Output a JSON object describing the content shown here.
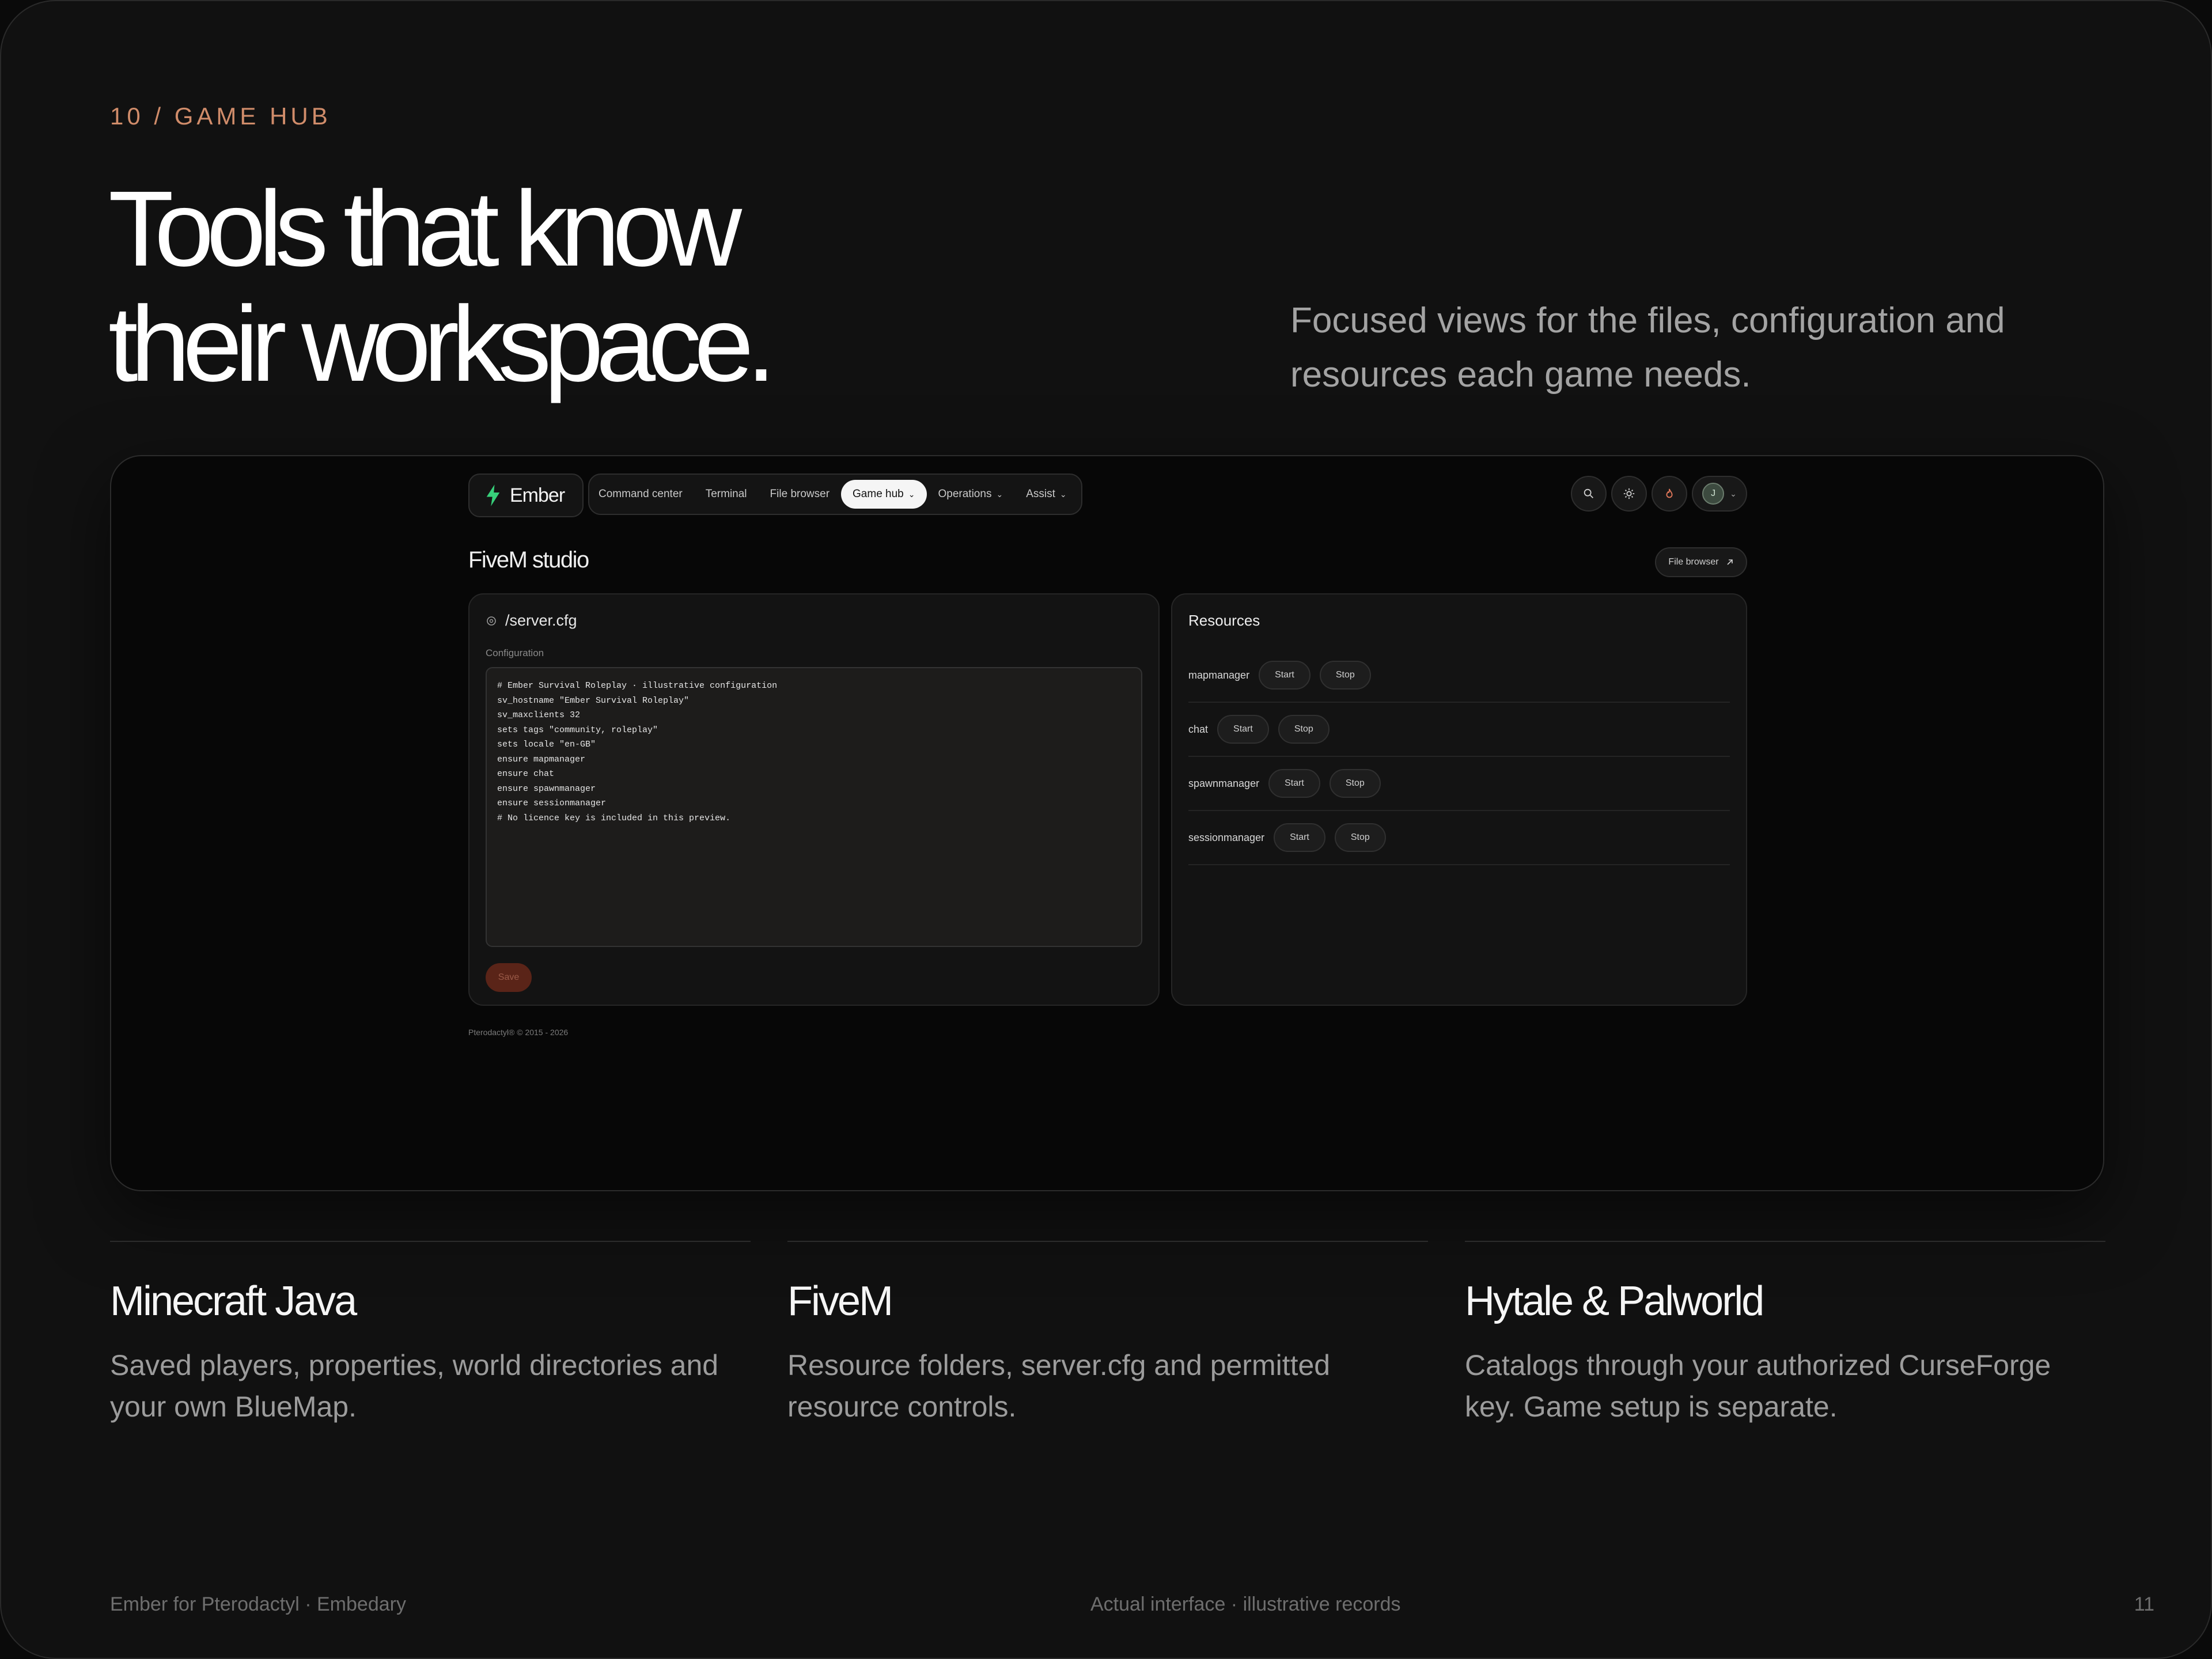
{
  "eyebrow": "10 / GAME HUB",
  "headline": {
    "line1": "Tools that know",
    "line2": "their workspace."
  },
  "lede": "Focused views for the files, configuration and resources each game needs.",
  "app": {
    "brand": "Ember",
    "nav": [
      {
        "label": "Command center"
      },
      {
        "label": "Terminal"
      },
      {
        "label": "File browser"
      },
      {
        "label": "Game hub",
        "active": true,
        "dropdown": true
      },
      {
        "label": "Operations",
        "dropdown": true
      },
      {
        "label": "Assist",
        "dropdown": true
      }
    ],
    "toolbar_icons": [
      "search-icon",
      "sun-icon",
      "flame-icon"
    ],
    "avatar_initial": "J",
    "studio_title": "FiveM studio",
    "file_browser_button": "File browser",
    "config": {
      "filename": "/server.cfg",
      "label": "Configuration",
      "content": "# Ember Survival Roleplay · illustrative configuration\nsv_hostname \"Ember Survival Roleplay\"\nsv_maxclients 32\nsets tags \"community, roleplay\"\nsets locale \"en-GB\"\nensure mapmanager\nensure chat\nensure spawnmanager\nensure sessionmanager\n# No licence key is included in this preview.",
      "save_label": "Save"
    },
    "resources": {
      "title": "Resources",
      "start_label": "Start",
      "stop_label": "Stop",
      "items": [
        {
          "name": "mapmanager"
        },
        {
          "name": "chat"
        },
        {
          "name": "spawnmanager"
        },
        {
          "name": "sessionmanager"
        }
      ]
    },
    "footer": "Pterodactyl® © 2015 - 2026"
  },
  "features": [
    {
      "title": "Minecraft Java",
      "text": "Saved players, properties, world directories and your own BlueMap."
    },
    {
      "title": "FiveM",
      "text": "Resource folders, server.cfg and permitted resource controls."
    },
    {
      "title": "Hytale & Palworld",
      "text": "Catalogs through your authorized CurseForge key. Game setup is separate."
    }
  ],
  "footer": {
    "left": "Ember for Pterodactyl · Embedary",
    "center": "Actual interface · illustrative records",
    "page": "11"
  },
  "colors": {
    "accent": "#d08c6a",
    "save": "#5a2418",
    "background": "#111111"
  }
}
